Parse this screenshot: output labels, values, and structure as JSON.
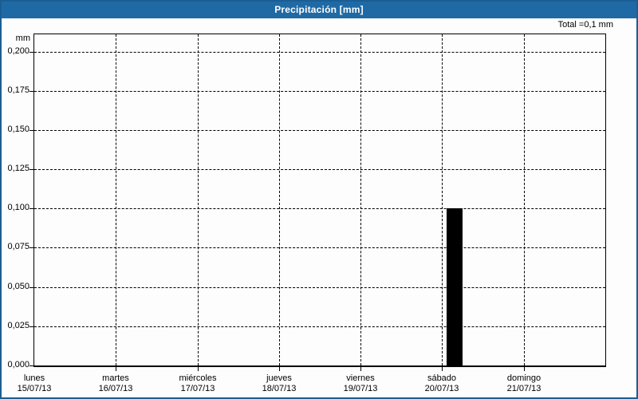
{
  "window": {
    "title": "Precipitación [mm]",
    "total_label": "Total =0,1 mm"
  },
  "colors": {
    "header_bg": "#1f6aa5",
    "header_text": "#ffffff",
    "frame_border": "#1b5e93",
    "background": "#fdfdfd",
    "grid": "#000000",
    "bar": "#000000"
  },
  "chart_data": {
    "type": "bar",
    "title": "Precipitación [mm]",
    "xlabel": "",
    "ylabel": "mm",
    "categories": [
      "lunes",
      "martes",
      "miércoles",
      "jueves",
      "viernes",
      "sábado",
      "domingo"
    ],
    "category_dates": [
      "15/07/13",
      "16/07/13",
      "17/07/13",
      "18/07/13",
      "19/07/13",
      "20/07/13",
      "21/07/13"
    ],
    "values": [
      0,
      0,
      0,
      0,
      0,
      0.1,
      0
    ],
    "total": "0,1 mm",
    "ylim": [
      0,
      0.211
    ],
    "yticks": [
      0,
      0.025,
      0.05,
      0.075,
      0.1,
      0.125,
      0.15,
      0.175,
      0.2
    ],
    "ytick_labels": [
      "0,000",
      "0,025",
      "0,050",
      "0,075",
      "0,100",
      "0,125",
      "0,150",
      "0,175",
      "0,200"
    ],
    "grid": "dashed",
    "legend_position": "none",
    "bar_color": "#000000"
  }
}
